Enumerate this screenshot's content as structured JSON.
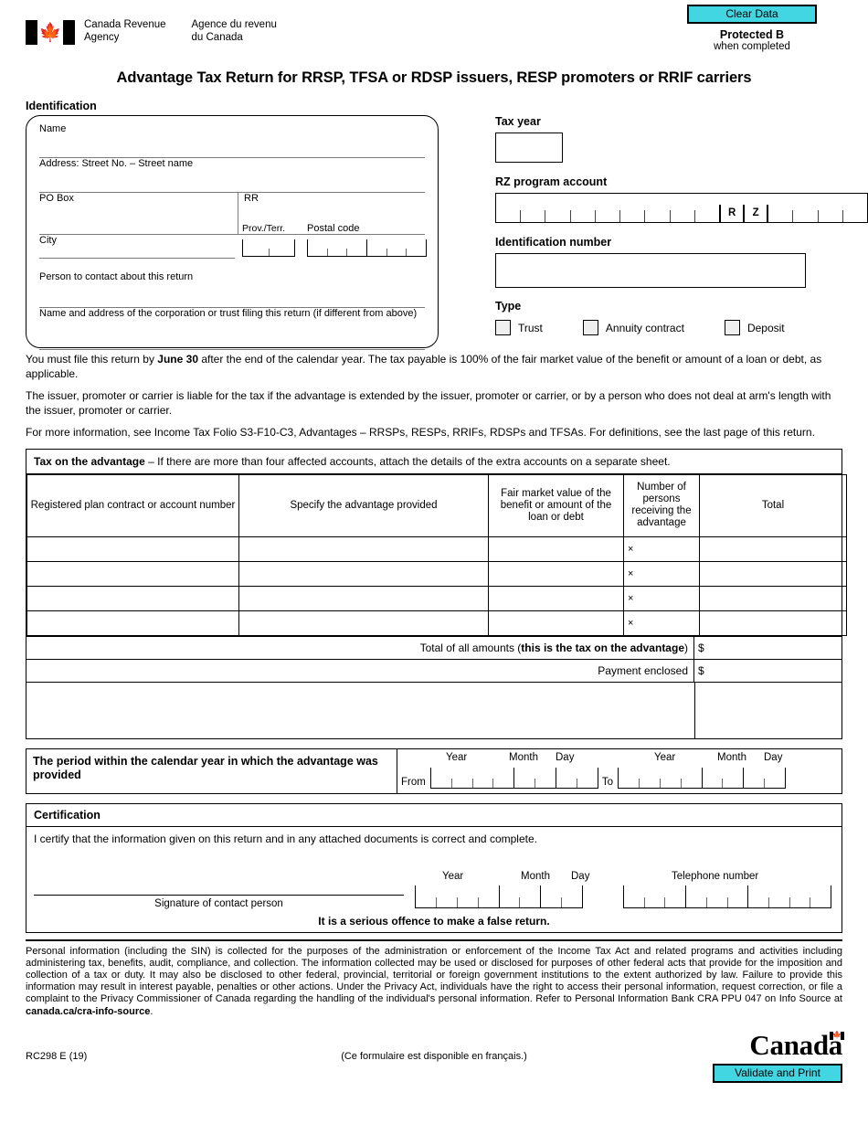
{
  "header": {
    "agency_en": "Canada Revenue\nAgency",
    "agency_fr": "Agence du revenu\ndu Canada",
    "clear_data_label": "Clear Data",
    "protected_label": "Protected B",
    "protected_sub": "when completed",
    "accent_color": "#42D6E3"
  },
  "title": "Advantage Tax Return for RRSP, TFSA or RDSP issuers, RESP promoters or RRIF carriers",
  "identification": {
    "heading": "Identification",
    "name_label": "Name",
    "address_label": "Address: Street No. – Street name",
    "po_box_label": "PO Box",
    "rr_label": "RR",
    "city_label": "City",
    "prov_label": "Prov./Terr.",
    "postal_label": "Postal code",
    "contact_label": "Person to contact about this return",
    "corp_label": "Name and address of the corporation or trust filing this return (if different from above)",
    "prov_cells": 2,
    "postal_cells": 6
  },
  "right_column": {
    "tax_year_label": "Tax year",
    "tax_year_value": "",
    "rz_label": "RZ program account",
    "rz_prefix_cells": 9,
    "rz_letter_1": "R",
    "rz_letter_2": "Z",
    "rz_suffix_cells": 4,
    "id_number_label": "Identification number",
    "id_number_value": "",
    "type_label": "Type",
    "types": [
      {
        "label": "Trust",
        "checked": false
      },
      {
        "label": "Annuity contract",
        "checked": false
      },
      {
        "label": "Deposit",
        "checked": false
      }
    ]
  },
  "paragraphs": [
    {
      "pre": "You must file this return by ",
      "bold": "June 30",
      "post": " after the end of the calendar year. The tax payable is 100% of the fair market value of the benefit or amount of a loan or debt, as applicable."
    },
    {
      "pre": "The issuer, promoter or carrier is liable for the tax if the advantage is extended by the issuer, promoter or carrier, or by a person who does not deal at arm's length with the issuer, promoter or carrier.",
      "bold": "",
      "post": ""
    },
    {
      "pre": "For more information, see Income Tax Folio S3-F10-C3, Advantages – RRSPs, RESPs, RRIFs, RDSPs and TFSAs. For definitions, see the last page of this return.",
      "bold": "",
      "post": ""
    }
  ],
  "advantage_table": {
    "title_bold": "Tax on the advantage",
    "title_rest": " – If there are more than four affected accounts, attach the details of the extra accounts on a separate sheet.",
    "columns": [
      "Registered plan contract or account number",
      "Specify the advantage provided",
      "Fair market value of the benefit or amount of the loan or debt",
      "Number of persons receiving the advantage",
      "Total"
    ],
    "multiply_symbol": "×",
    "rows": [
      {
        "account": "",
        "advantage": "",
        "fmv": "",
        "persons": "",
        "total": ""
      },
      {
        "account": "",
        "advantage": "",
        "fmv": "",
        "persons": "",
        "total": ""
      },
      {
        "account": "",
        "advantage": "",
        "fmv": "",
        "persons": "",
        "total": ""
      },
      {
        "account": "",
        "advantage": "",
        "fmv": "",
        "persons": "",
        "total": ""
      }
    ],
    "total_label_pre": "Total of all amounts (",
    "total_label_bold": "this is the tax on the advantage",
    "total_label_post": ")",
    "total_currency": "$",
    "total_value": "",
    "payment_label": "Payment enclosed",
    "payment_currency": "$",
    "payment_value": ""
  },
  "period": {
    "text": "The period within the calendar year in which the advantage was provided",
    "from_label": "From",
    "to_label": "To",
    "year_label": "Year",
    "month_label": "Month",
    "day_label": "Day",
    "year_cells": 4,
    "month_cells": 2,
    "day_cells": 2
  },
  "certification": {
    "heading": "Certification",
    "statement": "I certify that the information given on this return and in any attached documents is correct and complete.",
    "signature_caption": "Signature of contact person",
    "year_label": "Year",
    "month_label": "Month",
    "day_label": "Day",
    "telephone_label": "Telephone number",
    "telephone_cells": 10,
    "offence_notice": "It is a serious offence to make a false return."
  },
  "privacy": {
    "text_1": "Personal information (including the SIN) is collected for the purposes of the administration or enforcement of the Income Tax Act and related programs and activities including administering tax, benefits, audit, compliance, and collection. The information collected may be used or disclosed for purposes of other federal acts that provide for the imposition and collection of a tax or duty. It may also be disclosed to other federal, provincial, territorial or foreign government institutions to the extent authorized by law. Failure to provide this information may result in interest payable, penalties or other actions. Under the Privacy Act, individuals have the right to access their personal information, request correction, or file a complaint to the Privacy Commissioner of Canada regarding the handling of the individual's personal information. Refer to Personal Information Bank CRA PPU 047 on Info Source at ",
    "link": "canada.ca/cra-info-source",
    "text_2": "."
  },
  "footer": {
    "form_code": "RC298 E (19)",
    "french_note": "(Ce formulaire est disponible en français.)",
    "wordmark": "Canada",
    "validate_print_label": "Validate and Print"
  }
}
